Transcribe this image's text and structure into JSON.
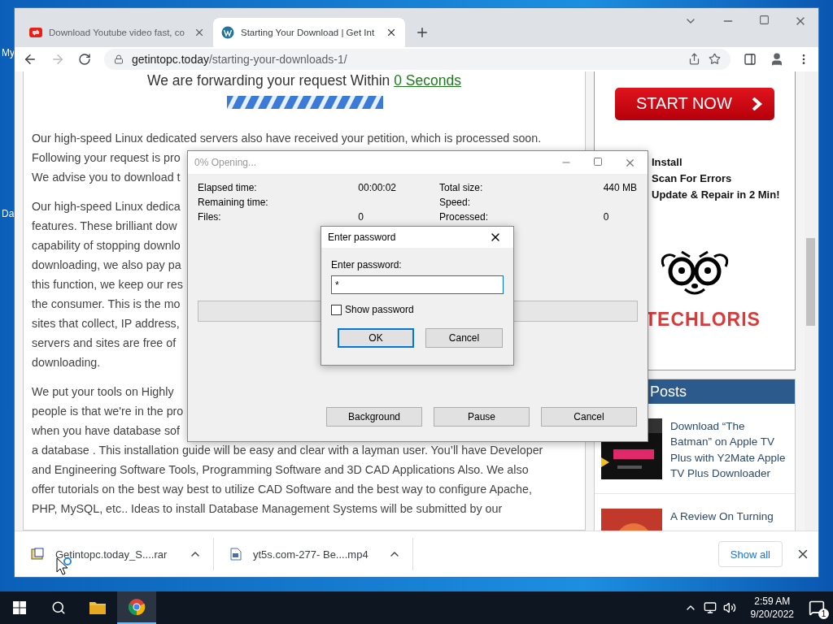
{
  "desktop": {
    "icon_labels": [
      "My",
      "Da"
    ]
  },
  "browser": {
    "tabs": [
      {
        "title": "Download Youtube video fast, co",
        "selected": false
      },
      {
        "title": "Starting Your Download | Get Int",
        "selected": true
      }
    ],
    "address": {
      "domain": "getintopc.today",
      "path": "/starting-your-downloads-1/"
    }
  },
  "page": {
    "heading": "We are forwarding your request Within ",
    "countdown_link": "0 Seconds",
    "paragraphs": [
      [
        "Our high-speed Linux dedicated servers also have received your petition, which is processed soon.",
        "Following your request is pro",
        "We advise you to download t"
      ],
      [
        "Our high-speed Linux dedica",
        "features. These brilliant dow",
        "capability of stopping downlo",
        "downloading, we also pay pa",
        "this function, we keep our res",
        "the consumer. This is the mo",
        "sites that collect, IP address,",
        "servers and sites are free of",
        "downloading."
      ],
      [
        "We put your tools on Highly",
        "people is that we're in the pro",
        "when you have database sof",
        "a database . This installation guide will be easy and clear with a layman user. You’ll have Developer",
        "and Engineering Software Tools, Programming Software and 3D CAD Applications Also. We also",
        "offer tutorials on the best way best to utilize CAD Software and the best way to configure Apache,",
        "PHP, MySQL, etc.. Ideas to install Database Management Systems will be submitted by our"
      ]
    ]
  },
  "sidebar": {
    "ad": {
      "button": "START NOW",
      "features": [
        "Install",
        "Scan For Errors",
        "Update & Repair in 2 Min!"
      ],
      "brand": "TECHLORIS"
    },
    "posts": {
      "header": "Posts",
      "items": [
        {
          "title": "Download “The Batman” on Apple TV Plus with Y2Mate Apple TV Plus Downloader"
        },
        {
          "title": "A Review On Turning"
        }
      ]
    }
  },
  "progress_dialog": {
    "title": "0% Opening...",
    "level": 0,
    "stats_left": [
      {
        "label": "Elapsed time:",
        "value": "00:00:02"
      },
      {
        "label": "Remaining time:"
      },
      {
        "label": "Files:",
        "value": "0"
      }
    ],
    "stats_right": [
      {
        "label": "Total size:",
        "value": "440 MB"
      },
      {
        "label": "Speed:"
      },
      {
        "label": "Processed:",
        "value": "0"
      }
    ],
    "buttons": [
      "Background",
      "Pause",
      "Cancel"
    ]
  },
  "password_dialog": {
    "title": "Enter password",
    "label": "Enter password:",
    "value": "*",
    "show_password": {
      "label": "Show password",
      "checked": false
    },
    "buttons": [
      "OK",
      "Cancel"
    ]
  },
  "downloads": {
    "items": [
      {
        "name": "Getintopc.today_S....rar",
        "kind": "archive"
      },
      {
        "name": "yt5s.com-277- Be....mp4",
        "kind": "video"
      }
    ],
    "show_all": "Show all"
  },
  "taskbar": {
    "time": "2:59 AM",
    "date": "9/20/2022",
    "notifications": "1"
  }
}
